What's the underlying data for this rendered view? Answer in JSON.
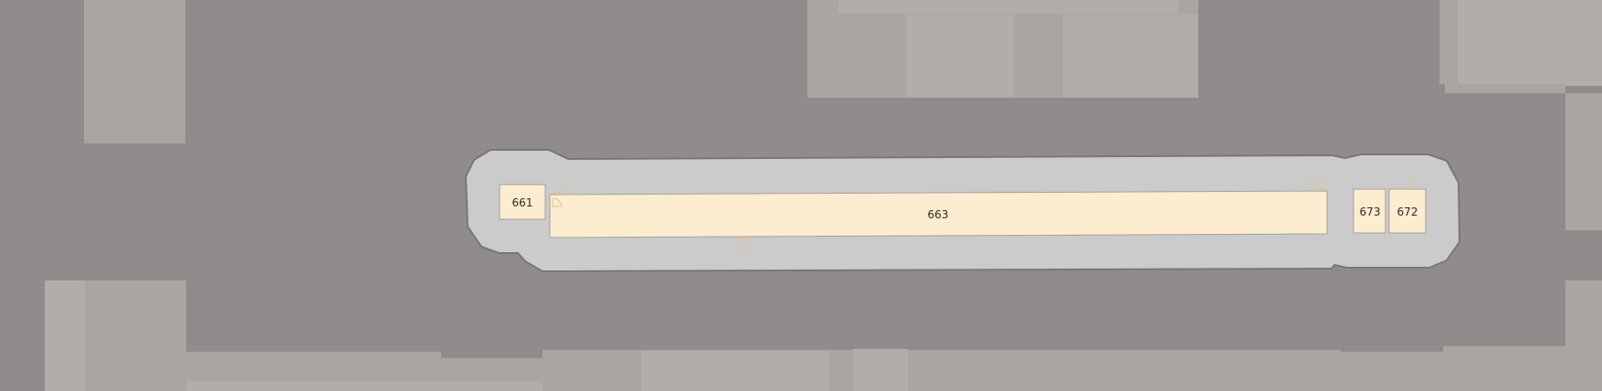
{
  "colors": {
    "background": "#908c8b",
    "building": "#aaa5a3",
    "building_light": "#b1adab",
    "corridor": "#cccbcb",
    "corridor_outline": "#7a7675",
    "room": "#fcecd0",
    "room_outline": "#a59f98",
    "door": "#e0c58a",
    "label": "#2c2a28"
  },
  "rooms": [
    {
      "id": "661",
      "label": "661"
    },
    {
      "id": "663",
      "label": "663"
    },
    {
      "id": "673",
      "label": "673"
    },
    {
      "id": "672",
      "label": "672"
    }
  ]
}
